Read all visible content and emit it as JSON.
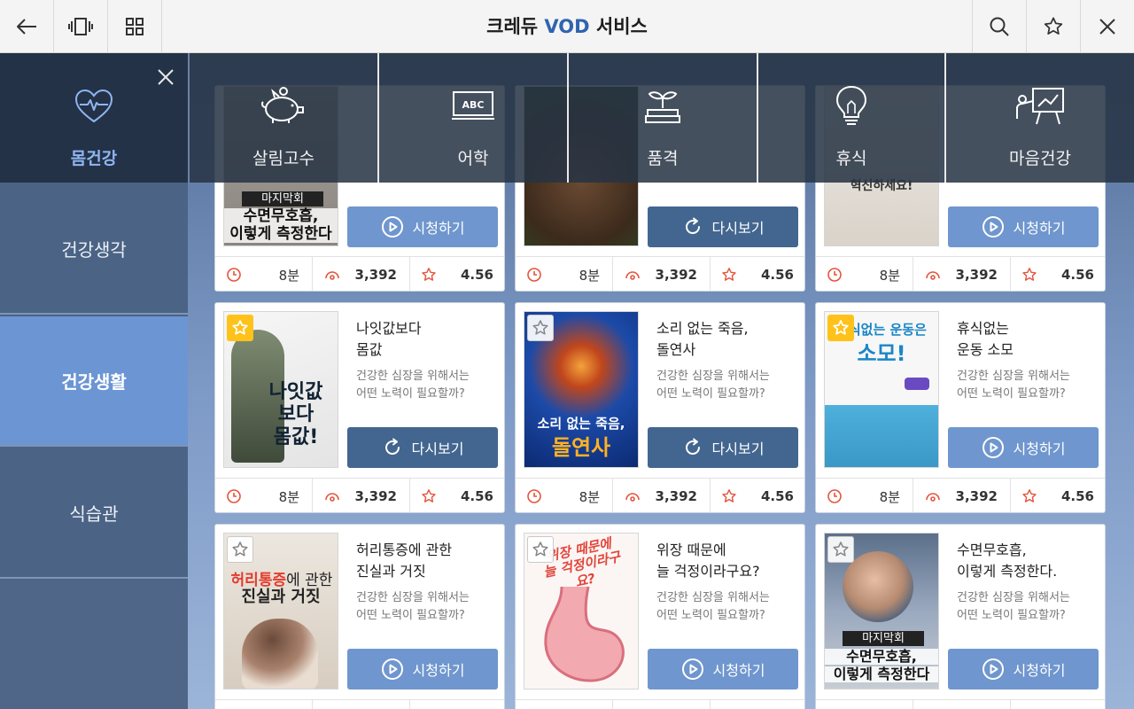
{
  "header": {
    "title_prefix": "크레듀 ",
    "title_accent": "VOD",
    "title_suffix": " 서비스"
  },
  "categories": [
    {
      "label": "몸건강",
      "icon": "heart-pulse-icon"
    },
    {
      "label": "살림고수",
      "icon": "piggy-bank-icon"
    },
    {
      "label": "어학",
      "icon": "abc-board-icon"
    },
    {
      "label": "품격",
      "icon": "sprout-books-icon"
    },
    {
      "label": "휴식",
      "icon": "light-bulb-icon"
    },
    {
      "label": "마음건강",
      "icon": "presentation-icon"
    }
  ],
  "sidebar": {
    "items": [
      {
        "label": "건강생각",
        "active": false
      },
      {
        "label": "건강생활",
        "active": true
      },
      {
        "label": "식습관",
        "active": false
      }
    ]
  },
  "stats_common": {
    "duration": "8분",
    "views": "3,392",
    "rating": "4.56"
  },
  "buttons": {
    "play": "시청하기",
    "replay": "다시보기"
  },
  "row0": [
    {
      "thumb_badge": "마지막회",
      "thumb_title": "수면무호흡,\n이렇게 측정한다",
      "button": "시청하기"
    },
    {
      "thumb_title": "",
      "button": "다시보기"
    },
    {
      "thumb_title": "혁신하세요!",
      "button": "시청하기"
    }
  ],
  "cards": [
    {
      "title": "나잇값보다\n몸값",
      "desc": "건강한 심장을 위해서는\n어떤 노력이 필요할까?",
      "thumb": "나잇값보다\n몸값!",
      "favorite": true,
      "button": "다시보기"
    },
    {
      "title": "소리 없는 죽음,\n돌연사",
      "desc": "건강한 심장을 위해서는\n어떤 노력이 필요할까?",
      "thumb_line1": "소리 없는 죽음,",
      "thumb_line2": "돌연사",
      "favorite": false,
      "button": "다시보기"
    },
    {
      "title": "휴식없는\n운동 소모",
      "desc": "건강한 심장을 위해서는\n어떤 노력이 필요할까?",
      "thumb_line1": "휴식없는 운동은",
      "thumb_line2": "소모!",
      "favorite": true,
      "button": "시청하기"
    },
    {
      "title": "허리통증에 관한\n진실과 거짓",
      "desc": "건강한 심장을 위해서는\n어떤 노력이 필요할까?",
      "thumb_line1a": "허리통증",
      "thumb_line1b": "에 관한",
      "thumb_line2": "진실과 거짓",
      "favorite": false,
      "button": "시청하기"
    },
    {
      "title": "위장 때문에\n늘 걱정이라구요?",
      "desc": "건강한 심장을 위해서는\n어떤 노력이 필요할까?",
      "thumb": "위장 때문에\n늘 걱정이라구요?",
      "favorite": false,
      "button": "시청하기"
    },
    {
      "title": "수면무호흡,\n이렇게 측정한다.",
      "desc": "건강한 심장을 위해서는\n어떤 노력이 필요할까?",
      "thumb_badge": "마지막회",
      "thumb_line1": "수면무호흡,",
      "thumb_line2": "이렇게 측정한다",
      "favorite": false,
      "button": "시청하기"
    }
  ],
  "colors": {
    "accent": "#2f63b0",
    "play_button": "#6f96ce",
    "replay_button": "#42668f",
    "favorite": "#ffc21a",
    "stat_icon": "#e4543c"
  }
}
